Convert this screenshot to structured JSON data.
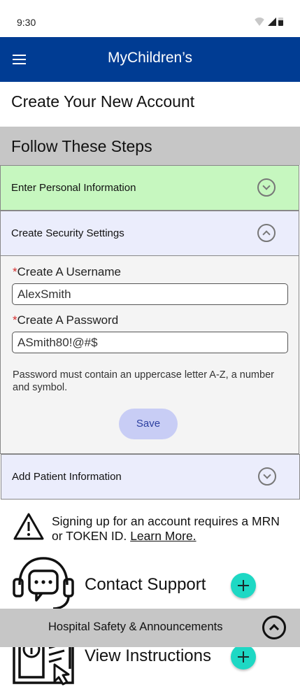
{
  "status_bar": {
    "time": "9:30"
  },
  "app_bar": {
    "title": "MyChildren’s"
  },
  "page": {
    "title": "Create Your New Account"
  },
  "steps": {
    "header": "Follow These Steps",
    "items": [
      {
        "label": "Enter Personal Information",
        "state": "collapsed",
        "color": "#c6f7bf"
      },
      {
        "label": "Create Security Settings",
        "state": "expanded",
        "color": "#ebedfc"
      },
      {
        "label": "Add Patient Information",
        "state": "collapsed",
        "color": "#ebedfc"
      }
    ]
  },
  "security": {
    "required_mark": "*",
    "username_label": "Create A Username",
    "username_value": "AlexSmith",
    "password_label": "Create A Password",
    "password_value": "ASmith80!@#$",
    "hint": "Password must contain an uppercase letter A-Z, a number and symbol.",
    "save_label": "Save"
  },
  "notice": {
    "icon": "warning-icon",
    "text": "Signing up for an account requires a MRN or TOKEN ID.",
    "link": "Learn More."
  },
  "actions": [
    {
      "icon": "support-headset-icon",
      "label": "Contact Support"
    },
    {
      "icon": "instructions-book-icon",
      "label": "View Instructions"
    }
  ],
  "banner": {
    "label": "Hospital Safety & Announcements"
  },
  "colors": {
    "app_bar": "#003c93",
    "accent_plus": "#1ed8c4",
    "save_button": "#c8cdf5",
    "required": "#d32f2f"
  }
}
